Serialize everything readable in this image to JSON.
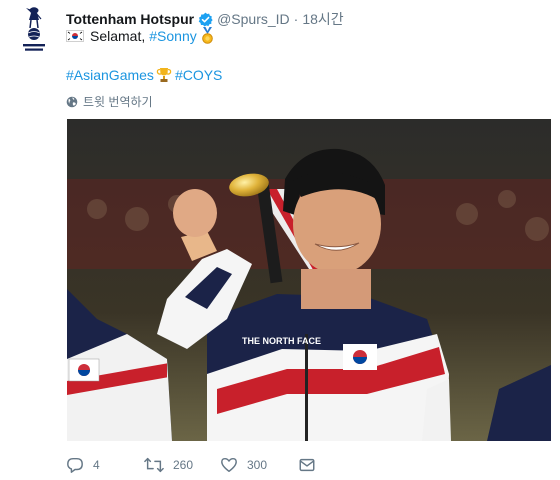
{
  "tweet": {
    "author_name": "Tottenham Hotspur",
    "author_handle": "@Spurs_ID",
    "separator": "·",
    "time": "18시간",
    "line1_text": "Selamat,",
    "line1_hashtag": "#Sonny",
    "line2_hashtag1": "#AsianGames",
    "line2_hashtag2": "#COYS",
    "translate_label": "트윗 번역하기"
  },
  "actions": {
    "replies": "4",
    "retweets": "260",
    "likes": "300"
  },
  "colors": {
    "link": "#1b95e0",
    "muted": "#657786",
    "verified": "#1da1f2",
    "spurs_navy": "#132257"
  },
  "icons": [
    "spurs-logo-icon",
    "verified-badge-icon",
    "korea-flag-emoji-icon",
    "medal-emoji-icon",
    "trophy-emoji-icon",
    "globe-icon",
    "reply-icon",
    "retweet-icon",
    "like-icon",
    "message-icon"
  ]
}
